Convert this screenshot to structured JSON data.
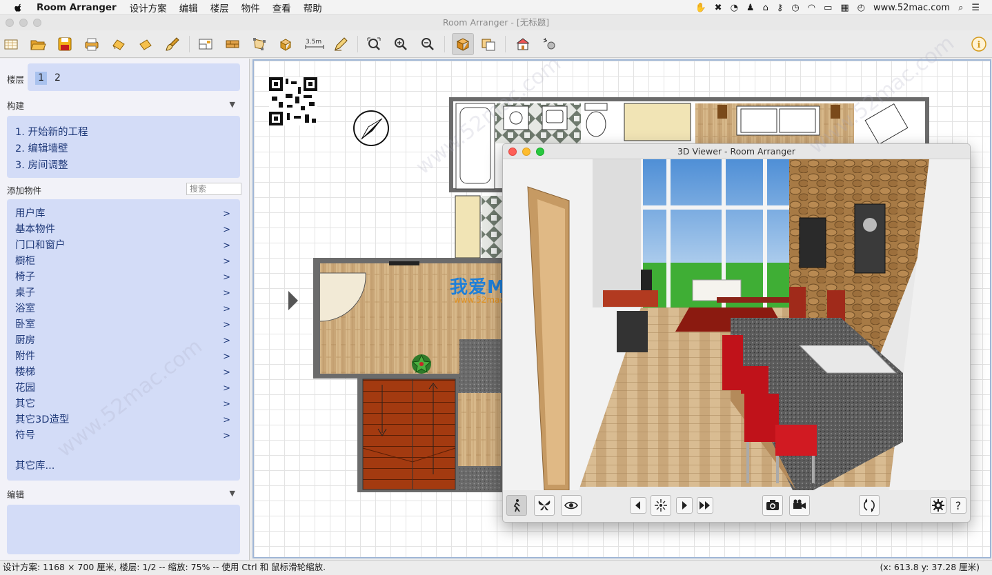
{
  "menubar": {
    "app_name": "Room Arranger",
    "items": [
      "设计方案",
      "编辑",
      "楼层",
      "物件",
      "查看",
      "帮助"
    ],
    "status_url": "www.52mac.com"
  },
  "window": {
    "title": "Room Arranger - [无标题]"
  },
  "toolbar": {
    "icons": [
      "new-icon",
      "open-icon",
      "save-icon",
      "print-icon",
      "undo-icon",
      "redo-icon",
      "paint-icon",
      "room-icon",
      "wall-icon",
      "polygon-icon",
      "object-icon",
      "dimension-icon",
      "pencil-icon",
      "zoom-fit-icon",
      "zoom-in-icon",
      "zoom-out-icon",
      "3d-box-icon",
      "3d-layers-icon",
      "house-icon",
      "settings-icon",
      "info-icon"
    ],
    "dimension_label": "3.5m"
  },
  "sidebar": {
    "floors_label": "楼层",
    "floors": [
      "1",
      "2"
    ],
    "build_label": "构建",
    "steps": [
      "1. 开始新的工程",
      "2. 编辑墙壁",
      "3. 房间调整"
    ],
    "add_objects_label": "添加物件",
    "search_placeholder": "搜索",
    "categories": [
      "用户库",
      "基本物件",
      "门口和窗户",
      "橱柜",
      "椅子",
      "桌子",
      "浴室",
      "卧室",
      "厨房",
      "附件",
      "楼梯",
      "花园",
      "其它",
      "其它3D造型",
      "符号"
    ],
    "category_arrow": ">",
    "other_libraries": "其它库...",
    "edit_label": "编辑"
  },
  "viewer": {
    "title": "3D Viewer - Room Arranger",
    "buttons": [
      "walk-icon",
      "fly-icon",
      "eye-icon",
      "prev-icon",
      "center-icon",
      "play-icon",
      "fast-forward-icon",
      "camera-icon",
      "video-icon",
      "rotate-icon",
      "gear-icon",
      "help-icon"
    ],
    "help_label": "?"
  },
  "watermark": {
    "brand": "我爱MAC",
    "url": "www.52mac.com"
  },
  "status": {
    "left": "设计方案: 1168 × 700 厘米, 楼层: 1/2 -- 缩放: 75% -- 使用 Ctrl 和 鼠标滑轮缩放.",
    "right": "(x: 613.8 y: 37.28 厘米)"
  },
  "colors": {
    "selection_blue": "#a9c2ee",
    "panel_blue": "#d3dcf7",
    "wood": "#c9a77a",
    "stair": "#a33a10"
  }
}
